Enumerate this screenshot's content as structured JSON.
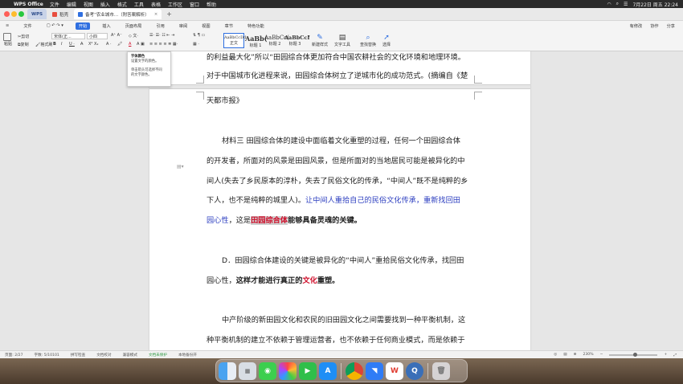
{
  "menubar": {
    "app_name": "WPS Office",
    "items": [
      "文件",
      "编辑",
      "视图",
      "插入",
      "格式",
      "工具",
      "表格",
      "工作区",
      "窗口",
      "帮助"
    ],
    "datetime": "7月22日 周五 22:24"
  },
  "tabs": {
    "wps": "WPS",
    "home": "稻壳",
    "document": "备考“农业城市...（附答案解析）"
  },
  "ribbon": {
    "file": "文件",
    "tabs": [
      "开始",
      "插入",
      "页面布局",
      "引用",
      "审阅",
      "视图",
      "章节",
      "特色功能"
    ],
    "active_tab": "开始",
    "right": [
      "有修改",
      "协作",
      "分享"
    ]
  },
  "toolbar": {
    "font_name": "宋体(正...",
    "font_size": "小四",
    "paste": "粘贴",
    "cut": "剪切",
    "copy": "复制",
    "format_painter": "格式刷",
    "styles": [
      {
        "sample": "AaBbCcDd",
        "name": "正文"
      },
      {
        "sample": "AaBb(",
        "name": "标题 1"
      },
      {
        "sample": "AaBbCc(",
        "name": "标题 2"
      },
      {
        "sample": "AaBbCcI",
        "name": "标题 3"
      }
    ],
    "new_style": "新建样式",
    "text_tools": "文字工具",
    "find_replace": "查找替换",
    "select": "选择"
  },
  "tooltip": {
    "title": "字体颜色",
    "line1": "设置文字的颜色。",
    "line2": "单击箭头可选择不同",
    "line3": "的文字颜色。"
  },
  "document": {
    "line1": "的利益最大化”所以“田园综合体更加符合中国农耕社会的文化环境和地理环境。",
    "line2": "对于中国城市化进程来说，田园综合体树立了逆城市化的成功范式。(摘编自《楚",
    "line3": "天都市报》",
    "p2_line1": "材料三    田园综合体的建设中面临着文化重塑的过程，任何一个田园综合体",
    "p2_line2": "的开发者，所面对的风景是田园风景，但是所面对的当地居民可能是被异化的中",
    "p2_line3": "间人(失去了乡民原本的淳朴，失去了民俗文化的传承，“中间人”既不是纯粹的乡",
    "p2_line4_a": "下人，也不是纯粹的城里人)。",
    "p2_line4_b": "让中间人重拾自己的民俗文化传承，",
    "p2_line4_c": "重新找回田",
    "p2_line5_a": "园心性",
    "p2_line5_b": "，这是",
    "p2_line5_c": "田园综合体",
    "p2_line5_d": "能够具备灵魂的关键。",
    "p3_line1": "D．田园综合体建设的关键是被异化的“中间人”重拾民俗文化传承，找回田",
    "p3_line2_a": "园心性，",
    "p3_line2_b": "这样才能进行真正的",
    "p3_line2_c": "文化",
    "p3_line2_d": "重塑。",
    "p4_line1": "中产阶级的新田园文化和农民的旧田园文化之间需要找到一种平衡机制，这",
    "p4_line2": "种平衡机制的建立不依赖于管理运营者，也不依赖于任何商业模式，而是依赖于"
  },
  "statusbar": {
    "page": "页面: 2/27",
    "words": "字数: 5/10101",
    "spell": "拼写检查",
    "doc_check": "文档校对",
    "compat": "兼容模式",
    "protect": "文档未保护",
    "local": "本地备份开",
    "zoom": "230%"
  },
  "dock": {
    "apps": [
      "finder",
      "launchpad",
      "messages",
      "photos",
      "facetime",
      "app-store",
      "chrome",
      "feishu",
      "wps",
      "quicktime",
      "trash"
    ]
  },
  "colors": {
    "accent": "#2f6fe0",
    "blue_text": "#2d3fc0",
    "red_text": "#d0102c"
  }
}
